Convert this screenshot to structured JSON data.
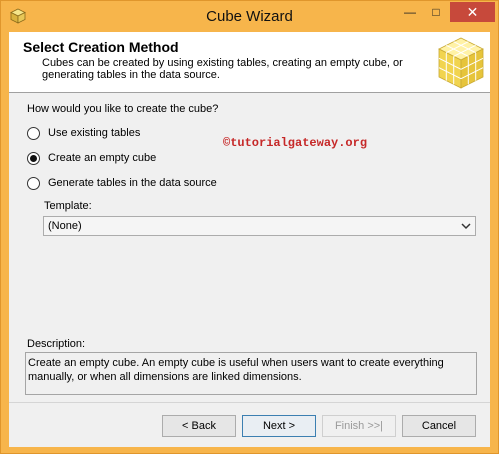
{
  "window": {
    "title": "Cube Wizard",
    "controls": {
      "minimize": "—",
      "maximize": "□",
      "close": "✕"
    }
  },
  "header": {
    "title": "Select Creation Method",
    "description": "Cubes can be created by using existing tables, creating an empty cube, or generating tables in the data source.",
    "image": "cube-icon"
  },
  "main": {
    "question": "How would you like to create the cube?",
    "options": [
      {
        "label": "Use existing tables",
        "checked": false
      },
      {
        "label": "Create an empty cube",
        "checked": true
      },
      {
        "label": "Generate tables in the data source",
        "checked": false
      }
    ],
    "watermark": "©tutorialgateway.org",
    "template_label": "Template:",
    "template_value": "(None)",
    "description_label": "Description:",
    "description_text": "Create an empty cube. An empty cube is useful when users want to create everything manually, or when all dimensions are linked dimensions."
  },
  "footer": {
    "back": "< Back",
    "next": "Next >",
    "finish": "Finish >>|",
    "cancel": "Cancel"
  },
  "colors": {
    "titlebar": "#f7b54b",
    "close_button": "#c7493b",
    "watermark": "#c62828"
  }
}
